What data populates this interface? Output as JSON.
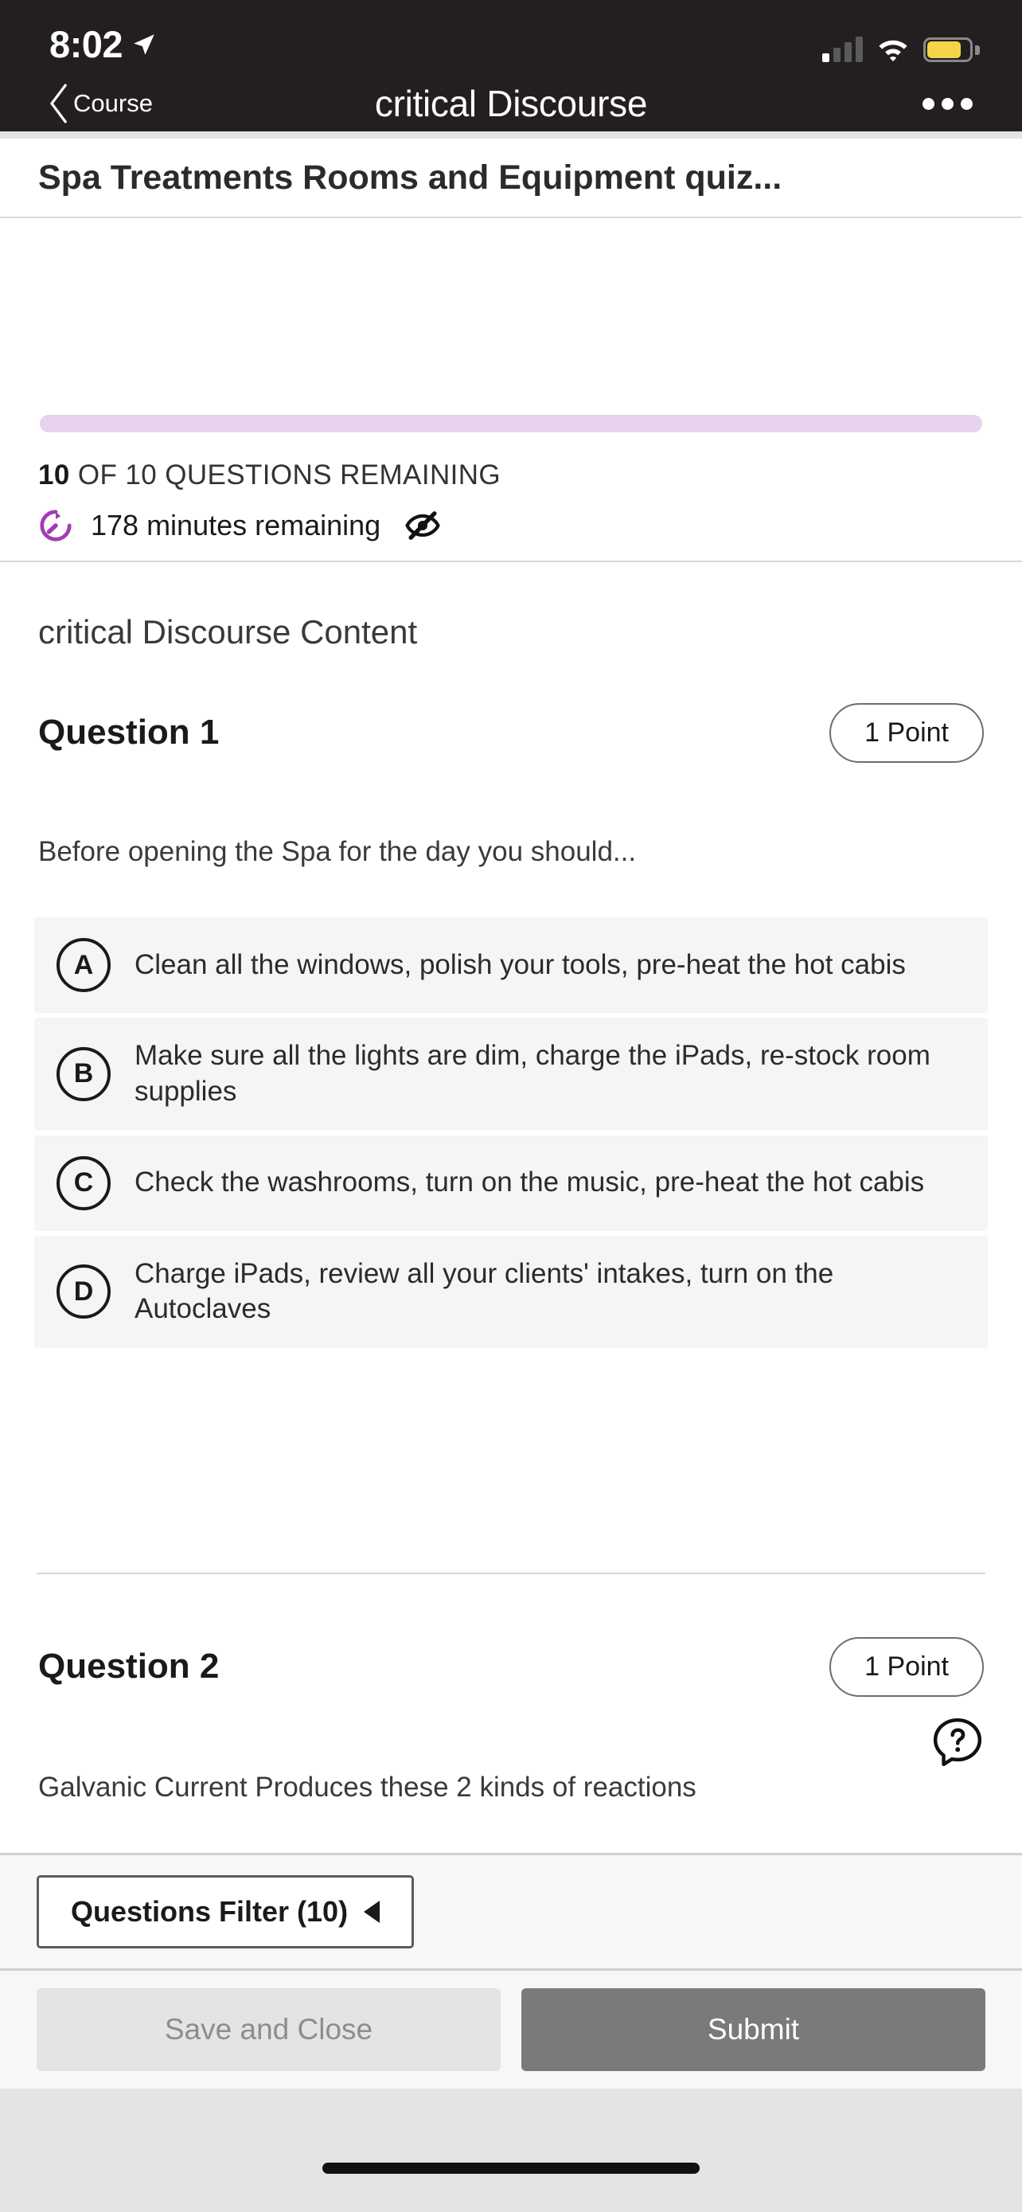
{
  "status_bar": {
    "time": "8:02",
    "location_icon": "location-arrow-icon",
    "signal_icon": "cellular-signal-icon",
    "signal_bars_active": 1,
    "signal_bars_total": 4,
    "wifi_icon": "wifi-icon",
    "battery_icon": "battery-icon",
    "battery_color": "#f5d547"
  },
  "nav_bar": {
    "back_label": "Course",
    "back_icon": "chevron-left-icon",
    "title": "critical Discourse",
    "more_icon": "more-horizontal-icon",
    "background": "#231f20"
  },
  "quiz": {
    "title": "Spa Treatments Rooms and Equipment quiz...",
    "progress": {
      "percent": 0,
      "track_color": "#e7d3ee",
      "fill_color": "#e7d3ee"
    },
    "questions_remaining_count": "10",
    "questions_remaining_suffix": " OF 10 QUESTIONS REMAINING",
    "timer_icon": "timer-icon",
    "timer_color": "#a23db5",
    "time_remaining": "178 minutes remaining",
    "hide_timer_icon": "eye-slash-icon",
    "content_heading": "critical Discourse Content"
  },
  "questions": [
    {
      "title": "Question 1",
      "points_label": "1 Point",
      "prompt": "Before opening the Spa for the day you should...",
      "options": [
        {
          "letter": "A",
          "text": "Clean all the windows, polish your tools, pre-heat the hot cabis"
        },
        {
          "letter": "B",
          "text": "Make sure all the lights are dim, charge the iPads, re-stock room supplies"
        },
        {
          "letter": "C",
          "text": "Check the washrooms, turn on the music, pre-heat the hot cabis"
        },
        {
          "letter": "D",
          "text": "Charge iPads, review all your clients' intakes, turn on the Autoclaves"
        }
      ]
    },
    {
      "title": "Question 2",
      "points_label": "1 Point",
      "prompt": "Galvanic Current Produces these 2 kinds of reactions"
    }
  ],
  "help": {
    "icon": "help-question-icon"
  },
  "filter_bar": {
    "label": "Questions Filter (10)",
    "chevron_icon": "triangle-left-icon"
  },
  "actions": {
    "save_label": "Save and Close",
    "submit_label": "Submit",
    "save_bg": "#e4e4e4",
    "submit_bg": "#7a7a7a"
  },
  "home_indicator": "home-indicator"
}
